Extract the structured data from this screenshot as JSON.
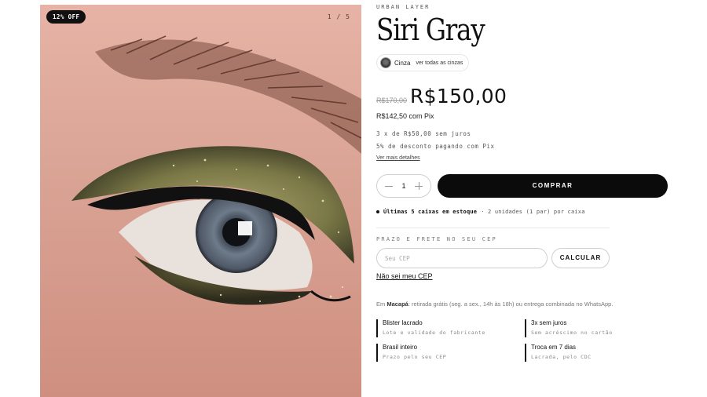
{
  "gallery": {
    "discount_badge": "12% OFF",
    "counter": "1 / 5",
    "image": "eye-makeup-photo"
  },
  "product": {
    "brand": "URBAN LAYER",
    "title": "Siri Gray",
    "swatch": {
      "name": "Cinza",
      "link": "ver todas as cinzas"
    },
    "old_price": "R$170,00",
    "price": "R$150,00",
    "pix_price": "R$142,50 com Pix",
    "installments": "3 x de R$50,00 sem juros",
    "pix_discount": "5% de desconto pagando com Pix",
    "details_link": "Ver mais detalhes"
  },
  "purchase": {
    "quantity": "1",
    "buy_label": "COMPRAR",
    "stock_strong": "Últimas 5 caixas em estoque",
    "stock_rest": "· 2 unidades (1 par) por caixa"
  },
  "shipping": {
    "label": "PRAZO E FRETE NO SEU CEP",
    "placeholder": "Seu CEP",
    "calc_label": "CALCULAR",
    "no_cep_link": "Não sei meu CEP",
    "pickup_prefix": "Em",
    "pickup_city": "Macapá",
    "pickup_rest": ": retirada grátis (seg. a sex., 14h às 18h) ou entrega combinada no WhatsApp."
  },
  "features": [
    {
      "title": "Blister lacrado",
      "subtitle": "Lote e validade do fabricante"
    },
    {
      "title": "3x sem juros",
      "subtitle": "Sem acréscimo no cartão"
    },
    {
      "title": "Brasil inteiro",
      "subtitle": "Prazo pelo seu CEP"
    },
    {
      "title": "Troca em 7 dias",
      "subtitle": "Lacrada, pelo CDC"
    }
  ],
  "colors": {
    "button": "#0b0b0b",
    "skin": "#d9a79b",
    "shadow": "#8a8652"
  }
}
